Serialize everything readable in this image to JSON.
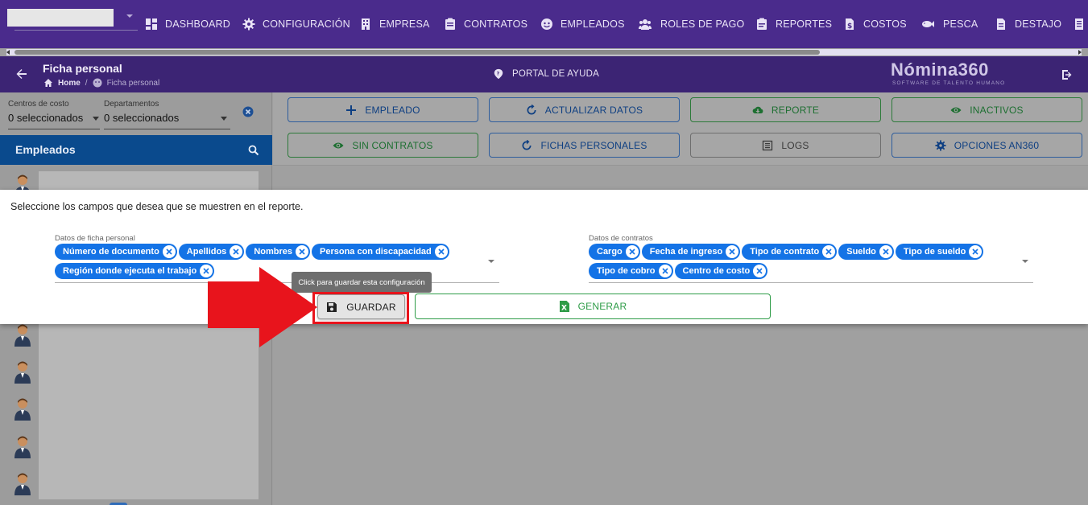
{
  "nav": {
    "items": [
      {
        "label": "DASHBOARD",
        "icon": "dashboard-icon"
      },
      {
        "label": "CONFIGURACIÓN",
        "icon": "gear-icon"
      },
      {
        "label": "EMPRESA",
        "icon": "building-icon"
      },
      {
        "label": "CONTRATOS",
        "icon": "clipboard-icon"
      },
      {
        "label": "EMPLEADOS",
        "icon": "face-icon"
      },
      {
        "label": "ROLES DE PAGO",
        "icon": "people-icon"
      },
      {
        "label": "REPORTES",
        "icon": "report-icon"
      },
      {
        "label": "COSTOS",
        "icon": "dollar-doc-icon"
      },
      {
        "label": "PESCA",
        "icon": "fish-icon"
      },
      {
        "label": "DESTAJO",
        "icon": "document-icon"
      }
    ]
  },
  "header": {
    "title": "Ficha personal",
    "breadcrumb_home": "Home",
    "breadcrumb_sep": "/",
    "breadcrumb_current": "Ficha personal",
    "help_label": "PORTAL DE AYUDA",
    "brand": "Nómina360",
    "brand_tagline": "SOFTWARE DE TALENTO HUMANO"
  },
  "filters": {
    "cost_centers_label": "Centros de costo",
    "cost_centers_value": "0 seleccionados",
    "departments_label": "Departamentos",
    "departments_value": "0 seleccionados"
  },
  "employees": {
    "title": "Empleados"
  },
  "toolbar": {
    "empleado": "EMPLEADO",
    "actualizar": "ACTUALIZAR DATOS",
    "reporte": "REPORTE",
    "inactivos": "INACTIVOS",
    "sin_contratos": "SIN CONTRATOS",
    "fichas": "FICHAS PERSONALES",
    "logs": "LOGS",
    "opciones": "OPCIONES AN360"
  },
  "dialog": {
    "instruction": "Seleccione los campos que desea que se muestren en el reporte.",
    "personal_label": "Datos de ficha personal",
    "personal_chips": [
      "Número de documento",
      "Apellidos",
      "Nombres",
      "Persona con discapacidad",
      "Región donde ejecuta el trabajo"
    ],
    "contracts_label": "Datos de contratos",
    "contract_chips": [
      "Cargo",
      "Fecha de ingreso",
      "Tipo de contrato",
      "Sueldo",
      "Tipo de sueldo",
      "Tipo de cobro",
      "Centro de costo"
    ],
    "tooltip": "Click para guardar esta configuración",
    "save_label": "GUARDAR",
    "generate_label": "GENERAR"
  },
  "colors": {
    "nav": "#4a2b8c",
    "header": "#3c2474",
    "employees_header": "#0a4a8d",
    "chip": "#1473e6",
    "generate": "#2e9c47",
    "highlight": "#e8141c"
  }
}
